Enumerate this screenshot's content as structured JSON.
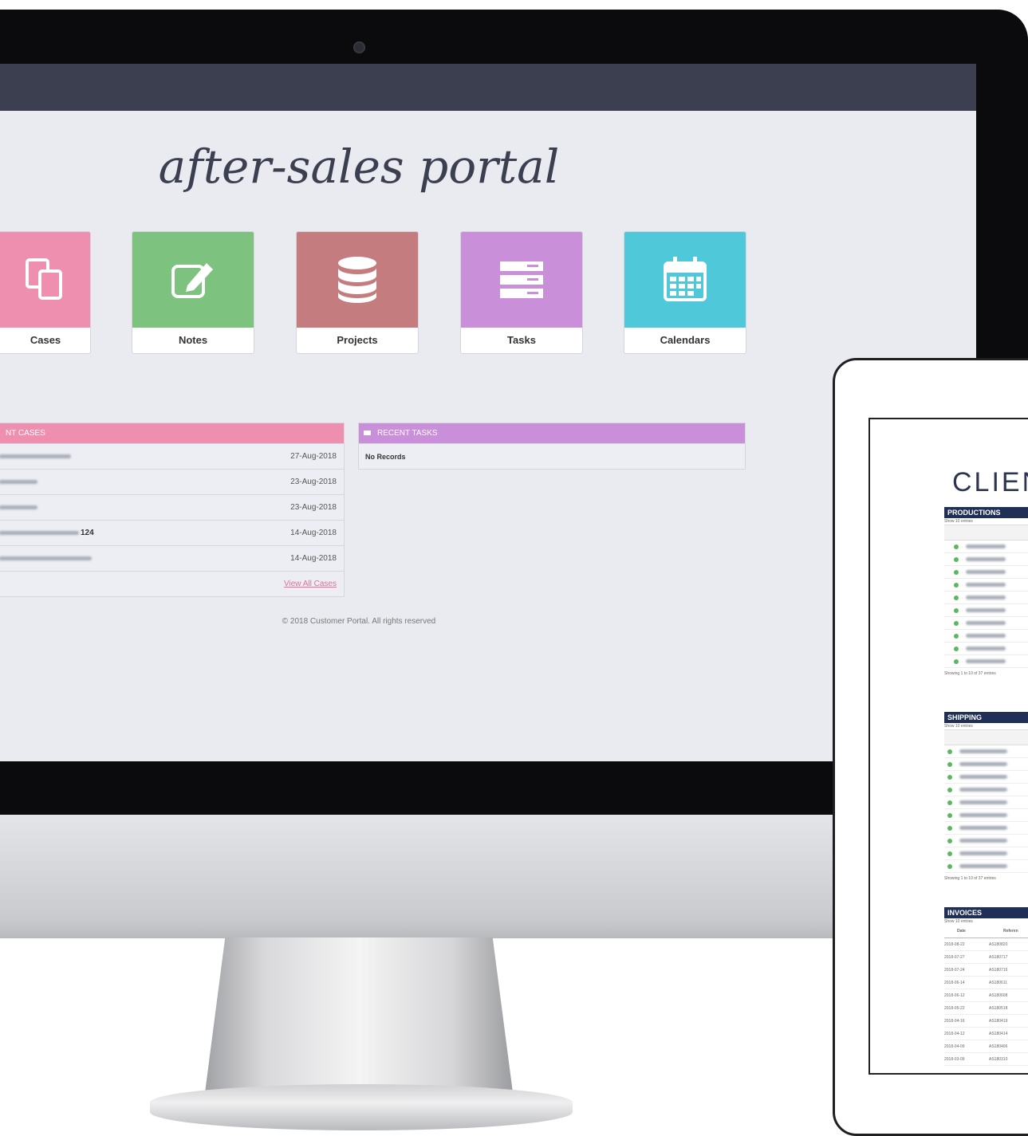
{
  "portal": {
    "title": "after-sales portal",
    "tiles": [
      {
        "label": "Cases",
        "color": "#ee8fb0",
        "icon": "copy-icon"
      },
      {
        "label": "Notes",
        "color": "#7dc27e",
        "icon": "edit-icon"
      },
      {
        "label": "Projects",
        "color": "#c57c7e",
        "icon": "database-icon"
      },
      {
        "label": "Tasks",
        "color": "#c98fd9",
        "icon": "server-icon"
      },
      {
        "label": "Calendars",
        "color": "#4fc9d9",
        "icon": "calendar-icon"
      }
    ],
    "recent_cases": {
      "header": "NT CASES",
      "rows": [
        {
          "date": "27-Aug-2018",
          "suffix": ""
        },
        {
          "date": "23-Aug-2018",
          "suffix": ""
        },
        {
          "date": "23-Aug-2018",
          "suffix": ""
        },
        {
          "date": "14-Aug-2018",
          "suffix": "124"
        },
        {
          "date": "14-Aug-2018",
          "suffix": ""
        }
      ],
      "view_all": "View All Cases"
    },
    "recent_tasks": {
      "header": "RECENT TASKS",
      "empty": "No Records"
    },
    "footer": "© 2018 Customer Portal. All rights reserved"
  },
  "tablet": {
    "title": "CLIEN",
    "productions": {
      "header": "PRODUCTIONS",
      "show": "Show 10 entries",
      "footer": "Showing 1 to 10 of 37 entries"
    },
    "shipping": {
      "header": "SHIPPING",
      "show": "Show 10 entries",
      "footer": "Showing 1 to 10 of 37 entries"
    },
    "invoices": {
      "header": "INVOICES",
      "show": "Show 10 entries",
      "col_date": "Date",
      "col_ref": "Referen",
      "rows": [
        {
          "date": "2018-08-22",
          "ref": "AS180820"
        },
        {
          "date": "2018-07-27",
          "ref": "AS180717"
        },
        {
          "date": "2018-07-24",
          "ref": "AS180716"
        },
        {
          "date": "2018-06-14",
          "ref": "AS180611"
        },
        {
          "date": "2018-06-12",
          "ref": "AS180608"
        },
        {
          "date": "2018-05-22",
          "ref": "AS180518"
        },
        {
          "date": "2018-04-16",
          "ref": "AS180419"
        },
        {
          "date": "2018-04-12",
          "ref": "AS180414"
        },
        {
          "date": "2018-04-09",
          "ref": "AS180406"
        },
        {
          "date": "2018-03-09",
          "ref": "AS180310"
        }
      ]
    }
  },
  "colors": {
    "recent_cases_header": "#ee8fb0",
    "recent_tasks_header": "#c98fd9",
    "topbar": "#3b3f4f"
  }
}
